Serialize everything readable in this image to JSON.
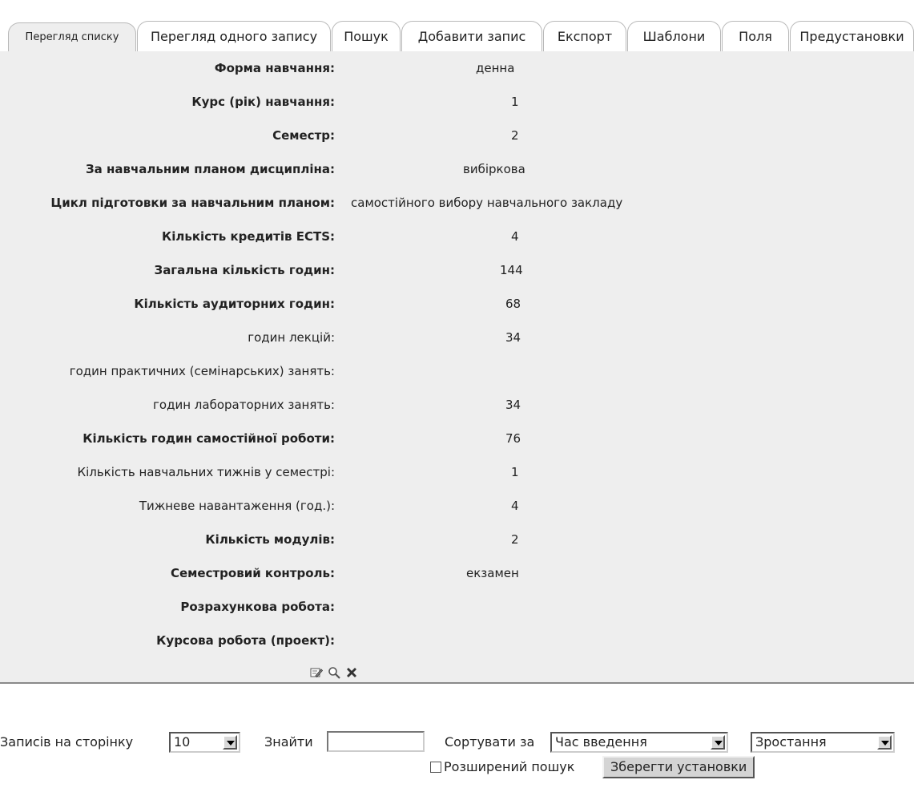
{
  "tabs": [
    {
      "label": "Перегляд списку",
      "active": true
    },
    {
      "label": "Перегляд одного запису"
    },
    {
      "label": "Пошук"
    },
    {
      "label": "Добавити запис"
    },
    {
      "label": "Експорт"
    },
    {
      "label": "Шаблони"
    },
    {
      "label": "Поля"
    },
    {
      "label": "Предустановки"
    }
  ],
  "fields": [
    {
      "label": "Форма навчання:",
      "value": "денна"
    },
    {
      "label": "Курс (рік) навчання:",
      "value": "1"
    },
    {
      "label": "Семестр:",
      "value": "2"
    },
    {
      "label": "За навчальним планом дисципліна:",
      "value": "вибіркова"
    },
    {
      "label": "Цикл підготовки за навчальним планом:",
      "value": "самостійного вибору навчального закладу"
    },
    {
      "label": "Кількість кредитів ECTS:",
      "value": "4"
    },
    {
      "label": "Загальна кількість годин:",
      "value": "144"
    },
    {
      "label": "Кількість аудиторних годин:",
      "value": "68"
    },
    {
      "label": "годин лекцій:",
      "value": "34"
    },
    {
      "label": "годин практичних (семінарських) занять:",
      "value": ""
    },
    {
      "label": "годин лабораторних занять:",
      "value": "34"
    },
    {
      "label": "Кількість годин самостійної роботи:",
      "value": "76"
    },
    {
      "label": "Кількість навчальних тижнів у семестрі:",
      "value": "1"
    },
    {
      "label": "Тижневе навантаження (год.):",
      "value": "4"
    },
    {
      "label": "Кількість модулів:",
      "value": "2"
    },
    {
      "label": "Семестровий контроль:",
      "value": "екзамен"
    },
    {
      "label": "Розрахункова робота:",
      "value": ""
    },
    {
      "label": "Курсова робота (проект):",
      "value": ""
    }
  ],
  "record_actions": {
    "icons": [
      "edit-icon",
      "view-icon",
      "delete-icon"
    ]
  },
  "controls": {
    "per_page_label": "Записів на сторінку",
    "per_page_value": "10",
    "search_label": "Знайти",
    "search_value": "",
    "sort_label": "Сортувати за",
    "sort_value": "Час введення",
    "order_value": "Зростання",
    "advanced_search_label": "Розширений пошук",
    "save_button": "Зберегти установки"
  }
}
